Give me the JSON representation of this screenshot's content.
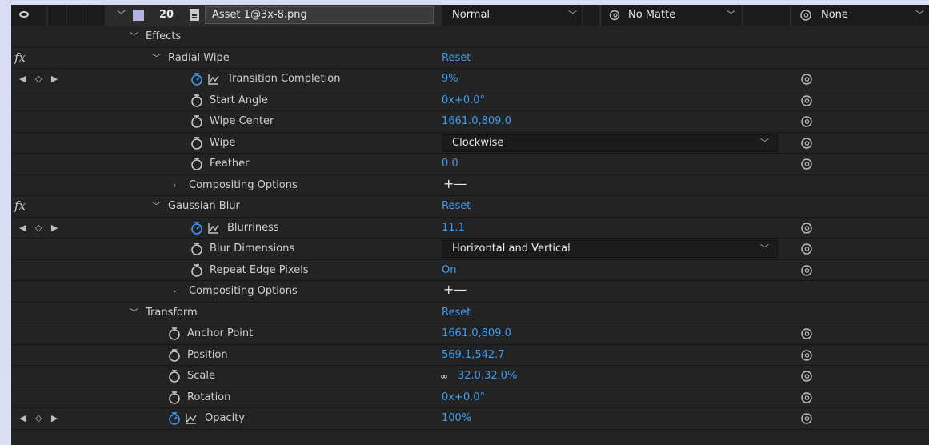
{
  "layer": {
    "index": "20",
    "name": "Asset 1@3x-8.png",
    "blend_mode": "Normal",
    "track_matte": "No Matte",
    "parent": "None"
  },
  "colors": {
    "value_blue": "#3e9cf0",
    "label_color": "#b3b3e0"
  },
  "rows": [
    {
      "label": "Effects",
      "kind": "group",
      "chevron": "down"
    },
    {
      "label": "Radial Wipe",
      "kind": "effect",
      "fx": "fx",
      "value": "Reset"
    },
    {
      "label": "Transition Completion",
      "kind": "prop",
      "animated": true,
      "value": "9%",
      "pick": "@"
    },
    {
      "label": "Start Angle",
      "kind": "prop",
      "value": "0x+0.0°",
      "pick": "@"
    },
    {
      "label": "Wipe Center",
      "kind": "prop",
      "value": "1661.0,809.0",
      "pick": "@"
    },
    {
      "label": "Wipe",
      "kind": "prop",
      "dropdown": "Clockwise",
      "pick": "@"
    },
    {
      "label": "Feather",
      "kind": "prop",
      "value": "0.0",
      "pick": "@"
    },
    {
      "label": "Compositing Options",
      "kind": "sub",
      "value": "+—"
    },
    {
      "label": "Gaussian Blur",
      "kind": "effect",
      "fx": "fx",
      "value": "Reset"
    },
    {
      "label": "Blurriness",
      "kind": "prop",
      "animated": true,
      "value": "11.1",
      "pick": "@"
    },
    {
      "label": "Blur Dimensions",
      "kind": "prop",
      "dropdown": "Horizontal and Vertical",
      "pick": "@"
    },
    {
      "label": "Repeat Edge Pixels",
      "kind": "prop",
      "value": "On",
      "pick": "@"
    },
    {
      "label": "Compositing Options",
      "kind": "sub",
      "value": "+—"
    },
    {
      "label": "Transform",
      "kind": "group2",
      "value": "Reset"
    },
    {
      "label": "Anchor Point",
      "kind": "tprop",
      "value": "1661.0,809.0",
      "pick": "@"
    },
    {
      "label": "Position",
      "kind": "tprop",
      "value": "569.1,542.7",
      "pick": "@"
    },
    {
      "label": "Scale",
      "kind": "tprop",
      "link": true,
      "value": "32.0,32.0%",
      "pick": "@"
    },
    {
      "label": "Rotation",
      "kind": "tprop",
      "value": "0x+0.0°",
      "pick": "@"
    },
    {
      "label": "Opacity",
      "kind": "tprop",
      "animated": true,
      "value": "100%",
      "pick": "@"
    }
  ]
}
